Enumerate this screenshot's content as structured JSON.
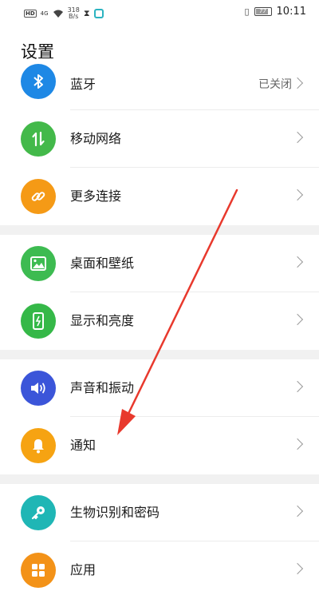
{
  "status_bar": {
    "hd_label": "HD",
    "signal_label": "4G",
    "speed_value": "318",
    "speed_unit": "B/s",
    "battery": "77",
    "time": "10:11"
  },
  "page": {
    "title": "设置"
  },
  "settings": {
    "bluetooth": {
      "label": "蓝牙",
      "value": "已关闭",
      "icon": "bluetooth-icon",
      "color": "#1e88e5"
    },
    "mobile_network": {
      "label": "移动网络",
      "icon": "mobile-data-icon",
      "color": "#43b94a"
    },
    "more_connections": {
      "label": "更多连接",
      "icon": "link-icon",
      "color": "#f59a16"
    },
    "home_wallpaper": {
      "label": "桌面和壁纸",
      "icon": "image-icon",
      "color": "#3dbb51"
    },
    "display_brightness": {
      "label": "显示和亮度",
      "icon": "phone-brightness-icon",
      "color": "#35b848"
    },
    "sound_vibration": {
      "label": "声音和振动",
      "icon": "speaker-icon",
      "color": "#3b55d9"
    },
    "notifications": {
      "label": "通知",
      "icon": "bell-icon",
      "color": "#f6a312"
    },
    "biometrics_password": {
      "label": "生物识别和密码",
      "icon": "key-icon",
      "color": "#1fb6b5"
    },
    "apps": {
      "label": "应用",
      "icon": "apps-grid-icon",
      "color": "#f39218"
    }
  },
  "annotation": {
    "arrow_color": "#e8392d"
  }
}
